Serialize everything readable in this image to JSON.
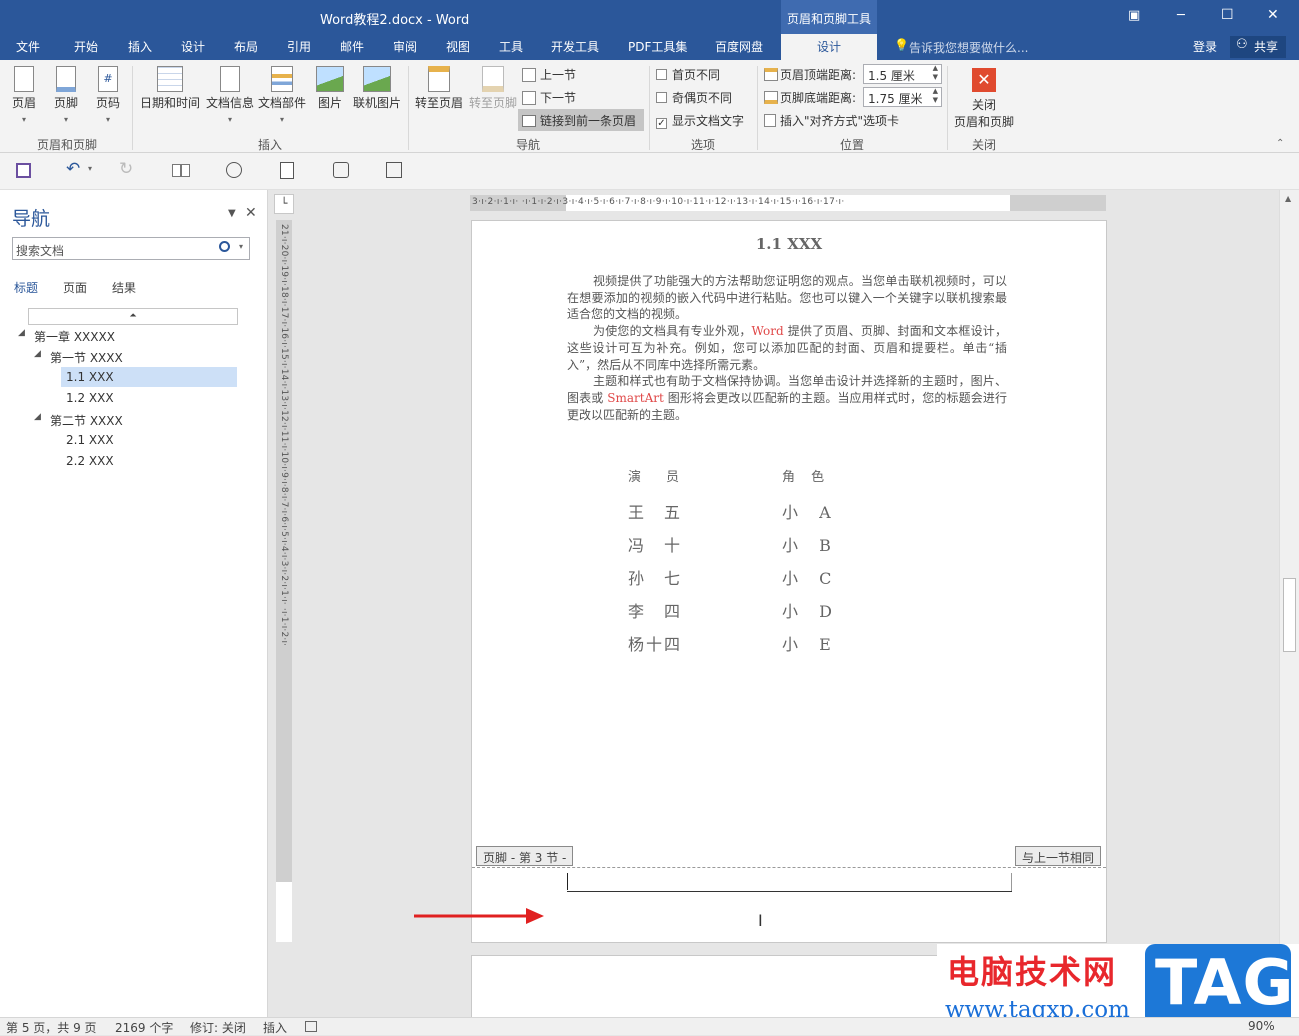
{
  "window": {
    "title": "Word教程2.docx - Word",
    "context_tool_title": "页眉和页脚工具",
    "controls": {
      "restore_ribbon": "▣",
      "minimize": "─",
      "maximize": "☐",
      "close": "✕"
    }
  },
  "tabs": [
    {
      "label": "文件"
    },
    {
      "label": "开始"
    },
    {
      "label": "插入"
    },
    {
      "label": "设计"
    },
    {
      "label": "布局"
    },
    {
      "label": "引用"
    },
    {
      "label": "邮件"
    },
    {
      "label": "审阅"
    },
    {
      "label": "视图"
    },
    {
      "label": "工具"
    },
    {
      "label": "开发工具"
    },
    {
      "label": "PDF工具集"
    },
    {
      "label": "百度网盘"
    },
    {
      "label": "设计",
      "active": true
    }
  ],
  "tell_me": "告诉我您想要做什么...",
  "account": {
    "login": "登录",
    "share": "共享"
  },
  "ribbon": {
    "header_footer_group": {
      "label": "页眉和页脚",
      "header": "页眉",
      "footer": "页脚",
      "page_number": "页码"
    },
    "insert_group": {
      "label": "插入",
      "datetime": "日期和时间",
      "docinfo": "文档信息",
      "quickparts": "文档部件",
      "picture": "图片",
      "online_picture": "联机图片"
    },
    "navigation_group": {
      "label": "导航",
      "goto_header": "转至页眉",
      "goto_footer": "转至页脚",
      "prev": "上一节",
      "next": "下一节",
      "link_prev": "链接到前一条页眉"
    },
    "options_group": {
      "label": "选项",
      "diff_first": "首页不同",
      "diff_odd_even": "奇偶页不同",
      "show_text": "显示文档文字"
    },
    "position_group": {
      "label": "位置",
      "header_top_label": "页眉顶端距离:",
      "header_top_value": "1.5 厘米",
      "footer_bottom_label": "页脚底端距离:",
      "footer_bottom_value": "1.75 厘米",
      "insert_align_tab": "插入\"对齐方式\"选项卡"
    },
    "close_group": {
      "label": "关闭",
      "close_line1": "关闭",
      "close_line2": "页眉和页脚"
    }
  },
  "navpane": {
    "title": "导航",
    "search_placeholder": "搜索文档",
    "tabs": [
      "标题",
      "页面",
      "结果"
    ],
    "tree": [
      {
        "label": "第一章 XXXXX",
        "level": 0,
        "expanded": true
      },
      {
        "label": "第一节 XXXX",
        "level": 1,
        "expanded": true
      },
      {
        "label": "1.1 XXX",
        "level": 2,
        "selected": true
      },
      {
        "label": "1.2 XXX",
        "level": 2
      },
      {
        "label": "第二节 XXXX",
        "level": 1,
        "expanded": true
      },
      {
        "label": "2.1 XXX",
        "level": 2
      },
      {
        "label": "2.2 XXX",
        "level": 2
      }
    ]
  },
  "ruler": {
    "horizontal": "3·ı·2·ı·1·ı·  ·ı·1·ı·2·ı·3·ı·4·ı·5·ı·6·ı·7·ı·8·ı·9·ı·10·ı·11·ı·12·ı·13·ı·14·ı·15·ı·16·ı·17·ı·",
    "vertical": "21·ı·20·ı·19·ı·18·ı·17·ı·16·ı·15·ı·14·ı·13·ı·12·ı·11·ı·10·ı·9·ı·8·ı·7·ı·6·ı·5·ı·4·ı·3·ı·2·ı·1·ı·  ·ı·1·ı·2·ı·"
  },
  "document": {
    "heading": "1.1 XXX",
    "paragraphs": [
      [
        {
          "t": "视频提供了功能强大的方法帮助您证明您的观点。当您单击联机视频时，可以在想要添加的视频的嵌入代码中进行粘贴。您也可以键入一个关键字以联机搜索最适合您的文档的视频。"
        }
      ],
      [
        {
          "t": "为使您的文档具有专业外观，"
        },
        {
          "t": "Word",
          "red": true
        },
        {
          "t": " 提供了页眉、页脚、封面和文本框设计，这些设计可互为补充。例如，您可以添加匹配的封面、页眉和提要栏。单击“插入”，然后从不同库中选择所需元素。"
        }
      ],
      [
        {
          "t": "主题和样式也有助于文档保持协调。当您单击设计并选择新的主题时，图片、图表或 "
        },
        {
          "t": "SmartArt",
          "red": true
        },
        {
          "t": " 图形将会更改以匹配新的主题。当应用样式时，您的标题会进行更改以匹配新的主题。"
        }
      ]
    ],
    "cast_header": [
      "演　员",
      "角 色"
    ],
    "cast": [
      [
        "王　五",
        "小 A"
      ],
      [
        "冯　十",
        "小 B"
      ],
      [
        "孙　七",
        "小 C"
      ],
      [
        "李　四",
        "小 D"
      ],
      [
        "杨十四",
        "小 E"
      ]
    ],
    "footer_tag": "页脚 - 第 3 节 -",
    "same_as_previous_tag": "与上一节相同"
  },
  "statusbar": {
    "page": "第 5 页，共 9 页",
    "words": "2169 个字",
    "track": "修订: 关闭",
    "mode": "插入",
    "zoom": "90%"
  },
  "watermark": {
    "site_name": "电脑技术网",
    "url": "www.tagxp.com",
    "logo": "TAG"
  },
  "colors": {
    "accent": "#2b579a",
    "red_text": "#e04848",
    "arrow": "#e02020"
  }
}
